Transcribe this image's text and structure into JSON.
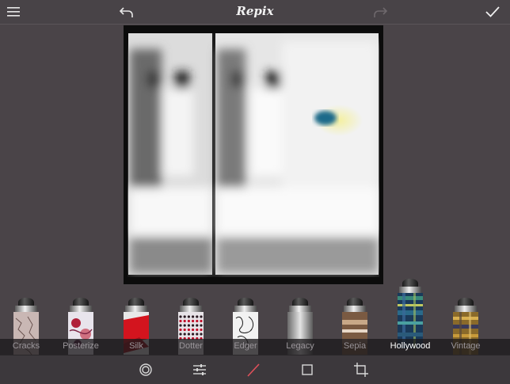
{
  "app": {
    "title": "Repix"
  },
  "colors": {
    "background": "#4a4448",
    "toolbar": "#3c383c",
    "active_tool": "#e0505a",
    "label_inactive": "#9a959a",
    "label_active": "#ffffff"
  },
  "topbar": {
    "icons": [
      "hamburger-menu-icon",
      "undo-arrow-icon",
      "redo-arrow-icon",
      "checkmark-icon"
    ]
  },
  "brushes": [
    {
      "label": "Cracks",
      "selected": false,
      "pattern": "cracks"
    },
    {
      "label": "Posterize",
      "selected": false,
      "pattern": "posterize"
    },
    {
      "label": "Silk",
      "selected": false,
      "pattern": "silk"
    },
    {
      "label": "Dotter",
      "selected": false,
      "pattern": "dotter"
    },
    {
      "label": "Edger",
      "selected": false,
      "pattern": "edger"
    },
    {
      "label": "Legacy",
      "selected": false,
      "pattern": "legacy"
    },
    {
      "label": "Sepia",
      "selected": false,
      "pattern": "sepia"
    },
    {
      "label": "Hollywood",
      "selected": true,
      "pattern": "hollywood"
    },
    {
      "label": "Vintage",
      "selected": false,
      "pattern": "vintage"
    }
  ],
  "bottom_tools": [
    {
      "icon": "circle-target-icon",
      "active": false
    },
    {
      "icon": "sliders-adjust-icon",
      "active": false
    },
    {
      "icon": "brush-pen-icon",
      "active": true
    },
    {
      "icon": "square-frame-icon",
      "active": false
    },
    {
      "icon": "crop-icon",
      "active": false
    }
  ]
}
